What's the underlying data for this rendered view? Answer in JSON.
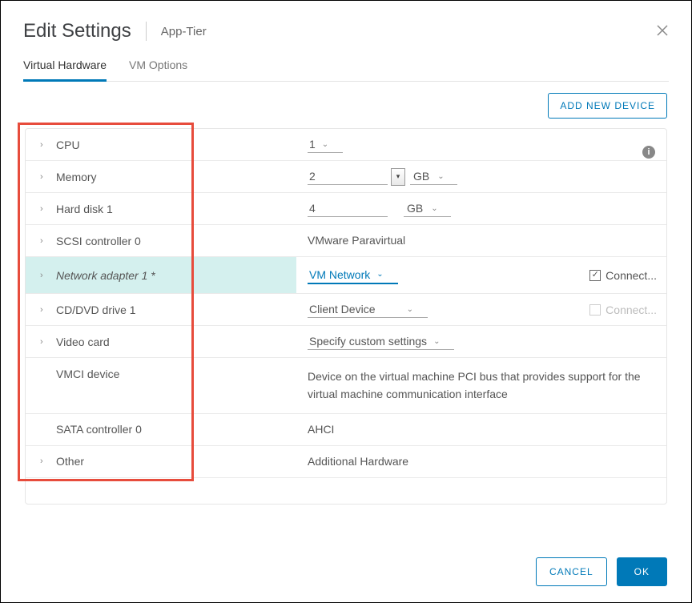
{
  "header": {
    "title": "Edit Settings",
    "subtitle": "App-Tier"
  },
  "tabs": {
    "hardware": "Virtual Hardware",
    "vmoptions": "VM Options"
  },
  "toolbar": {
    "add_device": "ADD NEW DEVICE"
  },
  "rows": {
    "cpu": {
      "label": "CPU",
      "value": "1"
    },
    "memory": {
      "label": "Memory",
      "value": "2",
      "unit": "GB"
    },
    "hard_disk": {
      "label": "Hard disk 1",
      "value": "4",
      "unit": "GB"
    },
    "scsi": {
      "label": "SCSI controller 0",
      "value": "VMware Paravirtual"
    },
    "net": {
      "label": "Network adapter 1 *",
      "value": "VM Network",
      "connect": "Connect..."
    },
    "cddvd": {
      "label": "CD/DVD drive 1",
      "value": "Client Device",
      "connect": "Connect..."
    },
    "video": {
      "label": "Video card",
      "value": "Specify custom settings"
    },
    "vmci": {
      "label": "VMCI device",
      "value": "Device on the virtual machine PCI bus that provides support for the virtual machine communication interface"
    },
    "sata": {
      "label": "SATA controller 0",
      "value": "AHCI"
    },
    "other": {
      "label": "Other",
      "value": "Additional Hardware"
    }
  },
  "footer": {
    "cancel": "CANCEL",
    "ok": "OK"
  },
  "icons": {
    "close": "✕",
    "check": "✓",
    "caret": "⌄",
    "chevron": "›",
    "info": "i"
  }
}
